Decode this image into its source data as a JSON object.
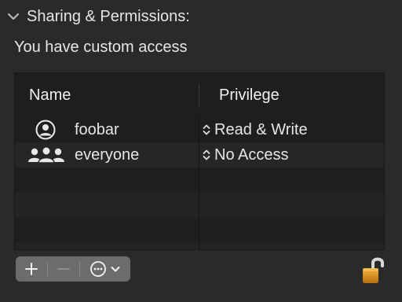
{
  "section": {
    "title": "Sharing & Permissions:",
    "expanded": true
  },
  "access_summary": "You have custom access",
  "table": {
    "columns": {
      "name": "Name",
      "privilege": "Privilege"
    },
    "rows": [
      {
        "icon": "user-icon",
        "name": "foobar",
        "privilege": "Read & Write"
      },
      {
        "icon": "group-icon",
        "name": "everyone",
        "privilege": "No Access"
      }
    ]
  },
  "toolbar": {
    "add_icon": "plus-icon",
    "remove_icon": "minus-icon",
    "action_icon": "ellipsis-circle-icon",
    "remove_enabled": false
  },
  "lock": {
    "icon": "unlocked-padlock-icon",
    "state": "unlocked"
  },
  "colors": {
    "background": "#2b2a2a",
    "table_bg": "#1e1e1e",
    "row_alt": "#262626",
    "toolbar_bg": "#6c6c6c",
    "lock_gold": "#d4901f"
  }
}
